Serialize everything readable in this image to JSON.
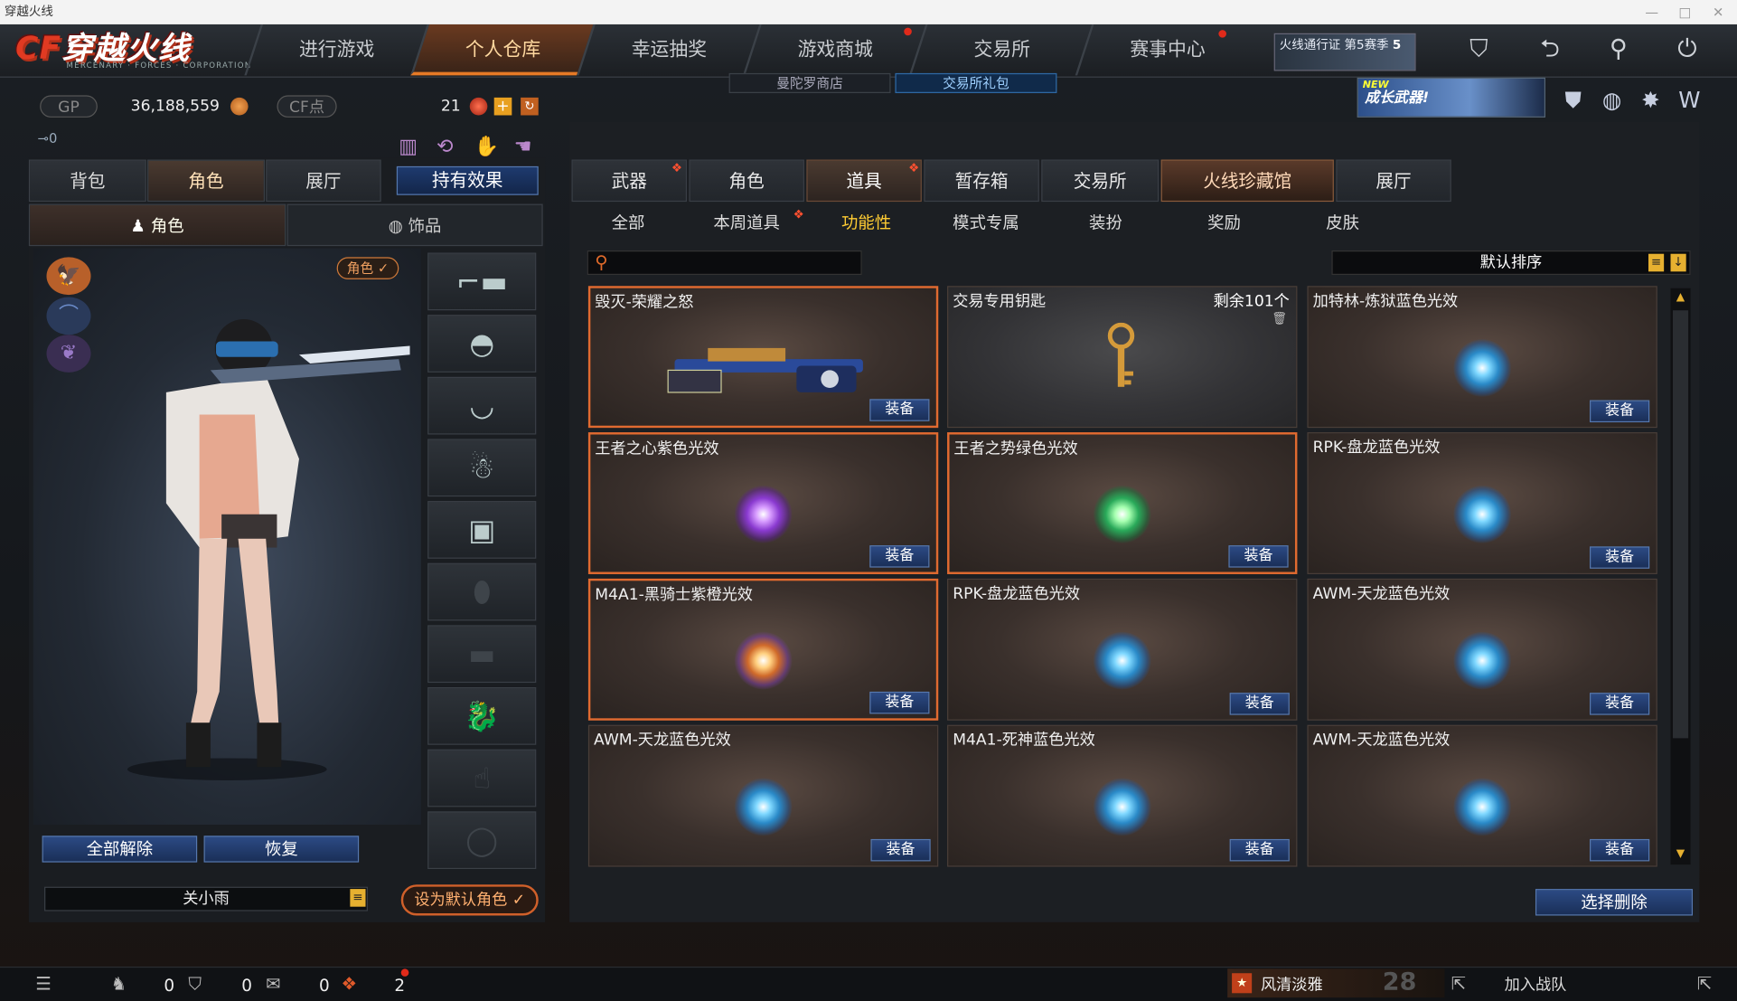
{
  "window": {
    "title": "穿越火线"
  },
  "logo": {
    "text": "穿越火线",
    "brand": "CF",
    "subtitle": "MERCENARY · FORCES · CORPORATION"
  },
  "topnav": {
    "tabs": [
      "进行游戏",
      "个人仓库",
      "幸运抽奖",
      "游戏商城",
      "交易所",
      "赛事中心"
    ],
    "active": "个人仓库",
    "subnav": [
      "曼陀罗商店",
      "交易所礼包"
    ],
    "pass_label": "火线通行证 第5赛季",
    "pass_level": "5"
  },
  "banner": {
    "new": "NEW",
    "text": "成长武器!"
  },
  "resources": {
    "gp_label": "GP",
    "gp_value": "36,188,559",
    "cf_label": "CF点",
    "ticket_count": "21",
    "key_count": "0"
  },
  "left": {
    "tabs": [
      "背包",
      "角色",
      "展厅"
    ],
    "active_tab": "角色",
    "effect_button": "持有效果",
    "subtabs": [
      "角色",
      "饰品"
    ],
    "role_badge": "角色 ✓",
    "buttons": {
      "unequip_all": "全部解除",
      "restore": "恢复",
      "set_default": "设为默认角色 ✓"
    },
    "character_name": "关小雨"
  },
  "right": {
    "tabs": [
      "武器",
      "角色",
      "道具",
      "暂存箱",
      "交易所",
      "火线珍藏馆",
      "展厅"
    ],
    "active_tab": "火线珍藏馆",
    "filters": [
      "全部",
      "本周道具",
      "功能性",
      "模式专属",
      "装扮",
      "奖励",
      "皮肤"
    ],
    "active_filter": "功能性",
    "search_placeholder": "",
    "sort_label": "默认排序",
    "delete_button": "选择删除",
    "equip_label": "装备",
    "items": [
      {
        "name": "毁灭-荣耀之怒",
        "type": "weapon"
      },
      {
        "name": "交易专用钥匙",
        "count": "剩余101个",
        "type": "key"
      },
      {
        "name": "加特林-炼狱蓝色光效",
        "type": "orb-blue"
      },
      {
        "name": "王者之心紫色光效",
        "type": "orb-purple"
      },
      {
        "name": "王者之势绿色光效",
        "type": "orb-green"
      },
      {
        "name": "RPK-盘龙蓝色光效",
        "type": "orb-blue"
      },
      {
        "name": "M4A1-黑骑士紫橙光效",
        "type": "orb-orange"
      },
      {
        "name": "RPK-盘龙蓝色光效",
        "type": "orb-blue"
      },
      {
        "name": "AWM-天龙蓝色光效",
        "type": "orb-blue"
      },
      {
        "name": "AWM-天龙蓝色光效",
        "type": "orb-blue"
      },
      {
        "name": "M4A1-死神蓝色光效",
        "type": "orb-blue"
      },
      {
        "name": "AWM-天龙蓝色光效",
        "type": "orb-blue"
      }
    ]
  },
  "bottom": {
    "friends": "0",
    "team": "0",
    "messages": "0",
    "gifts": "2",
    "clan_name": "风清淡雅",
    "clan_level": "28",
    "join_team": "加入战队"
  }
}
